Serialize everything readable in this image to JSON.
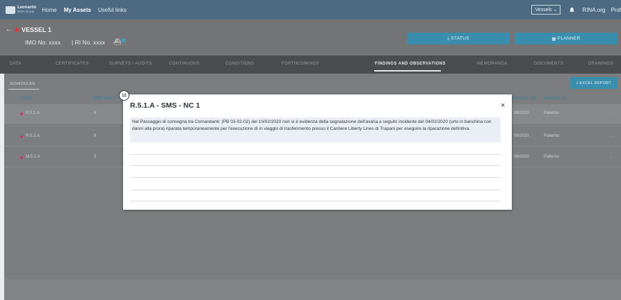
{
  "nav": {
    "logo_line1": "Leonardo",
    "logo_line2": "RINA Group",
    "links": [
      "Home",
      "My Assets",
      "Useful links"
    ],
    "vessels_label": "Vessels",
    "rina_label": "RINA.org",
    "profile_label": "Prof"
  },
  "vessel": {
    "name": "VESSEL 1",
    "imo": "IMO No. xxxx",
    "ri": "| RI No. xxxx"
  },
  "actions": {
    "status": "STATUS",
    "planner": "PLANNER",
    "excel": "EXCEL REPORT"
  },
  "tabs": [
    "DATA",
    "CERTIFICATES",
    "SURVEYS / AUDITS",
    "CONTINUOUS",
    "CONDITIONS",
    "FORTHCOMINGS",
    "FINDINGS AND OBSERVATIONS",
    "MEMORANDA",
    "DOCUMENTS",
    "DRAWINGS"
  ],
  "active_tab": "FINDINGS AND OBSERVATIONS",
  "subtab": "SCHEDULED",
  "columns": {
    "code": "CODE",
    "ref_rule": "REF RULE",
    "issued_on": "ISSUED ON",
    "issued_at": "ISSUED AT"
  },
  "rows": [
    {
      "code": "R.5.1.A",
      "ref": "6",
      "issued_on": "06/2020",
      "issued_at": "Palermo"
    },
    {
      "code": "R.5.2.A",
      "ref": "9",
      "issued_on": "06/2020",
      "issued_at": "Palermo"
    },
    {
      "code": "M.5.1.A",
      "ref": "3",
      "issued_on": "06/2020",
      "issued_at": "Palermo"
    }
  ],
  "modal": {
    "badge": "12",
    "title": "R.5.1.A - SMS - NC 1",
    "close": "×",
    "text": "Nel Passaggio di consegna tra Comandanti: (PB 03-02-02) del 10/02/2020 non vi è evidenza della segnalazione dell'avaria a seguito incidente del 04/02/2020 (urto in banchina con danni alla prora) riparata temporaneamente per l'esecuzione di in viaggio di trasferimento presso il Cantiere Liberty Lines di Trapani per eseguire la riparazione definitiva."
  },
  "colors": {
    "nav_bg": "#4d6a82",
    "accent": "#3a8ead",
    "status_dot": "#e2343c",
    "row_dot": "#c43c62"
  }
}
